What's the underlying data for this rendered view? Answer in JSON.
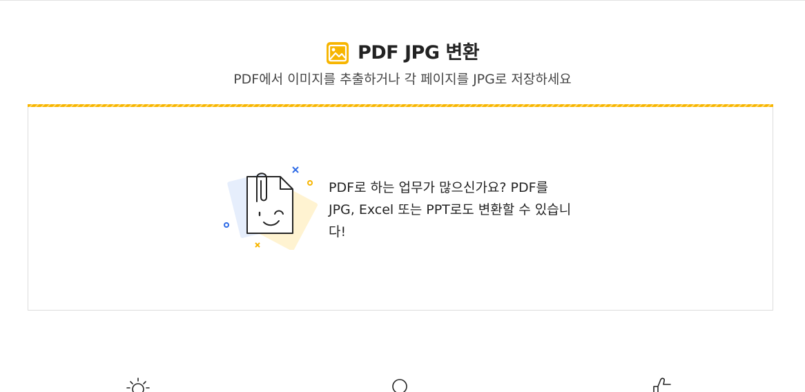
{
  "header": {
    "title": "PDF JPG 변환",
    "subtitle": "PDF에서 이미지를 추출하거나 각 페이지를 JPG로 저장하세요",
    "icon": "image-icon"
  },
  "drop_zone": {
    "message": "PDF로 하는 업무가 많으신가요? PDF를 JPG, Excel 또는 PPT로도 변환할 수 있습니다!",
    "illustration": "smiling-document-icon"
  },
  "features": [
    {
      "icon": "lightbulb-icon"
    },
    {
      "icon": "circle-icon"
    },
    {
      "icon": "thumbs-up-icon"
    }
  ],
  "colors": {
    "accent": "#f7b500",
    "accent_light": "#ffd766",
    "blue_accent": "#2e6be6",
    "paper_blue": "#e6eefc",
    "paper_yellow": "#fff3d1"
  }
}
